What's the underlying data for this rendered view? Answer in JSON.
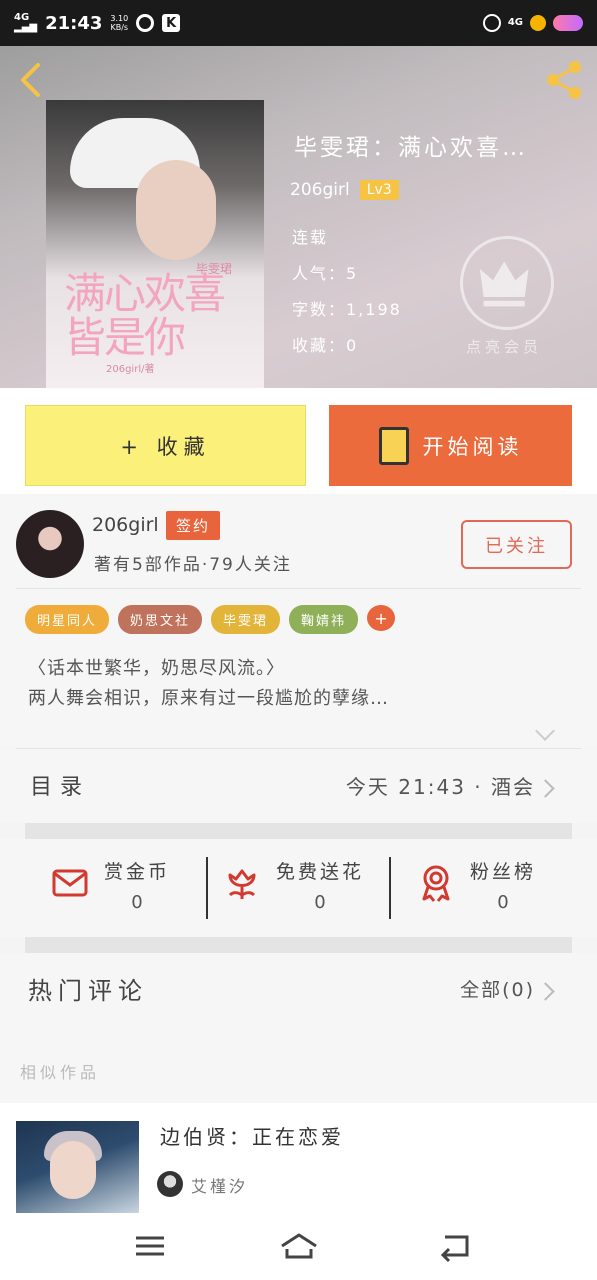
{
  "status_bar": {
    "network": "4G",
    "time": "21:43",
    "speed_value": "3.10",
    "speed_unit": "KB/s",
    "app_badge": "K",
    "right_network": "4G"
  },
  "book": {
    "title": "毕雯珺：满心欢喜…",
    "author": "206girl",
    "level": "Lv3",
    "status": "连载",
    "popularity": "人气：5",
    "word_count": "字数：1,198",
    "favorites": "收藏：0",
    "vip_label": "点亮会员",
    "cover": {
      "title_line1": "满心欢喜",
      "title_line2": "皆是你",
      "subtitle": "毕雯珺",
      "author": "206girl/著"
    }
  },
  "actions": {
    "collect_label": "+ 收藏",
    "read_label": "开始阅读"
  },
  "author_card": {
    "name": "206girl",
    "signed_badge": "签约",
    "stats": "著有5部作品·79人关注",
    "follow_label": "已关注"
  },
  "tags": [
    {
      "label": "明星同人",
      "color": "#f0ac3a"
    },
    {
      "label": "奶思文社",
      "color": "#c0735c"
    },
    {
      "label": "毕雯珺",
      "color": "#e2b43a"
    },
    {
      "label": "鞠婧祎",
      "color": "#8fb058"
    }
  ],
  "tag_more": "+",
  "intro": {
    "line1": "〈话本世繁华，奶思尽风流。〉",
    "line2": "两人舞会相识，原来有过一段尴尬的孽缘…"
  },
  "catalog": {
    "label": "目录",
    "latest": "今天 21:43 · 酒会"
  },
  "stats": [
    {
      "label": "赏金币",
      "value": "0",
      "icon": "red-envelope-icon"
    },
    {
      "label": "免费送花",
      "value": "0",
      "icon": "flower-icon"
    },
    {
      "label": "粉丝榜",
      "value": "0",
      "icon": "medal-icon"
    }
  ],
  "comments": {
    "label": "热门评论",
    "all": "全部(0)"
  },
  "similar": {
    "section_label": "相似作品",
    "title": "边伯贤：正在恋爱",
    "author": "艾槿汐"
  },
  "colors": {
    "accent_orange": "#ec6b3c",
    "collect_yellow": "#fbf07a",
    "level_gold": "#f6c342",
    "icon_red": "#d2392f"
  }
}
